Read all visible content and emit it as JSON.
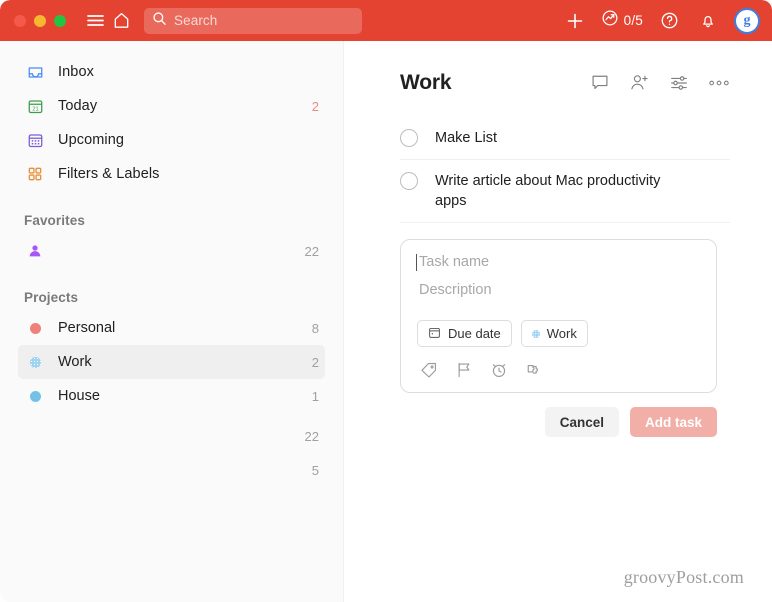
{
  "titlebar": {
    "traffic_lights": [
      "close",
      "minimize",
      "maximize"
    ],
    "menu_icon": "hamburger-menu-icon",
    "home_icon": "home-icon",
    "search": {
      "placeholder": "Search",
      "icon": "search-icon"
    },
    "add_icon": "plus-icon",
    "karma": {
      "icon": "productivity-chart-icon",
      "count": "0/5"
    },
    "help_icon": "question-mark-circle-icon",
    "notifications_icon": "bell-icon",
    "avatar": {
      "initial": "g"
    },
    "accent_color": "#E44332"
  },
  "sidebar": {
    "nav": [
      {
        "label": "Inbox",
        "icon": "inbox-icon",
        "count": "",
        "color": "#4A8CF7"
      },
      {
        "label": "Today",
        "icon": "calendar-today-icon",
        "count": "2",
        "color": "#3CA04B",
        "count_color": "#EB8A81"
      },
      {
        "label": "Upcoming",
        "icon": "calendar-upcoming-icon",
        "count": "",
        "color": "#7C5BD6"
      },
      {
        "label": "Filters & Labels",
        "icon": "filters-labels-grid-icon",
        "count": "",
        "color": "#E8913A"
      }
    ],
    "favorites": {
      "title": "Favorites",
      "items": [
        {
          "label": "",
          "icon": "person-icon",
          "count": "22",
          "color": "#A855F7"
        }
      ]
    },
    "projects": {
      "title": "Projects",
      "items": [
        {
          "label": "Personal",
          "count": "8",
          "color": "#EE8179",
          "active": false,
          "dot_style": "solid"
        },
        {
          "label": "Work",
          "count": "2",
          "color": "#9FD3EE",
          "active": true,
          "dot_style": "hatch"
        },
        {
          "label": "House",
          "count": "1",
          "color": "#73C2E3",
          "active": false,
          "dot_style": "solid"
        },
        {
          "label": "",
          "count": "22",
          "color": "",
          "active": false,
          "dot_style": "none"
        },
        {
          "label": "",
          "count": "5",
          "color": "",
          "active": false,
          "dot_style": "none"
        }
      ]
    }
  },
  "main": {
    "title": "Work",
    "header_actions": [
      {
        "name": "comments-icon"
      },
      {
        "name": "add-person-icon"
      },
      {
        "name": "view-options-icon"
      },
      {
        "name": "more-options-icon"
      }
    ],
    "tasks": [
      {
        "text": "Make List",
        "completed": false
      },
      {
        "text": "Write article about Mac productivity apps",
        "completed": false
      }
    ],
    "composer": {
      "task_name_placeholder": "Task name",
      "description_placeholder": "Description",
      "chips": [
        {
          "label": "Due date",
          "icon": "calendar-icon"
        },
        {
          "label": "Work",
          "icon": "project-dot",
          "color": "#6FC0E8"
        }
      ],
      "quick_icons": [
        {
          "name": "label-tag-icon"
        },
        {
          "name": "priority-flag-icon"
        },
        {
          "name": "reminder-alarm-icon"
        },
        {
          "name": "extensions-puzzle-icon"
        }
      ],
      "cancel_label": "Cancel",
      "add_label": "Add task"
    }
  },
  "watermark": "groovyPost.com"
}
